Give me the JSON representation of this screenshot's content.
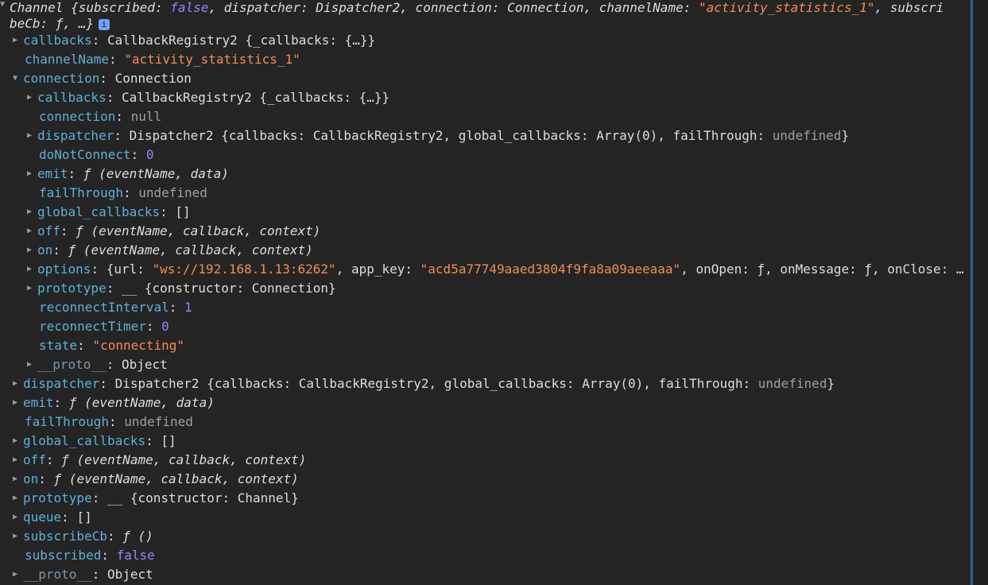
{
  "header": {
    "line1": {
      "prefix": "Channel {subscribed: ",
      "subscribed": "false",
      "mid": ", dispatcher: Dispatcher2, connection: Connection, channelName: ",
      "channel": "\"activity_statistics_1\"",
      "tail": ", subscri"
    },
    "line2": "beCb: ƒ, …}",
    "info_badge": "i"
  },
  "rows": {
    "r01": {
      "key": "callbacks",
      "val": "CallbackRegistry2 {_callbacks: {…}}"
    },
    "r02": {
      "key": "channelName",
      "val": "\"activity_statistics_1\""
    },
    "r03": {
      "key": "connection",
      "val": "Connection"
    },
    "r04": {
      "key": "callbacks",
      "val": "CallbackRegistry2 {_callbacks: {…}}"
    },
    "r05": {
      "key": "connection",
      "val": "null"
    },
    "r06": {
      "key": "dispatcher",
      "val": "Dispatcher2 {callbacks: CallbackRegistry2, global_callbacks: Array(0), failThrough: ",
      "undef": "undefined",
      "close": "}"
    },
    "r07": {
      "key": "doNotConnect",
      "val": "0"
    },
    "r08": {
      "key": "emit",
      "f": "ƒ",
      "sig": " (eventName, data)"
    },
    "r09": {
      "key": "failThrough",
      "val": "undefined"
    },
    "r10": {
      "key": "global_callbacks",
      "val": "[]"
    },
    "r11": {
      "key": "off",
      "f": "ƒ",
      "sig": " (eventName, callback, context)"
    },
    "r12": {
      "key": "on",
      "f": "ƒ",
      "sig": " (eventName, callback, context)"
    },
    "r13": {
      "key": "options",
      "p1": "{url: ",
      "url": "\"ws://192.168.1.13:6262\"",
      "p2": ", app_key: ",
      "app_key": "\"acd5a77749aaed3804f9fa8a09aeeaaa\"",
      "p3": ", onOpen: ƒ, onMessage: ƒ, onClose: ƒ, onError: ƒ}"
    },
    "r14": {
      "key": "prototype",
      "val": "__ {constructor: Connection}"
    },
    "r15": {
      "key": "reconnectInterval",
      "val": "1"
    },
    "r16": {
      "key": "reconnectTimer",
      "val": "0"
    },
    "r17": {
      "key": "state",
      "val": "\"connecting\""
    },
    "r18": {
      "key": "__proto__",
      "val": "Object"
    },
    "r19": {
      "key": "dispatcher",
      "val": "Dispatcher2 {callbacks: CallbackRegistry2, global_callbacks: Array(0), failThrough: ",
      "undef": "undefined",
      "close": "}"
    },
    "r20": {
      "key": "emit",
      "f": "ƒ",
      "sig": " (eventName, data)"
    },
    "r21": {
      "key": "failThrough",
      "val": "undefined"
    },
    "r22": {
      "key": "global_callbacks",
      "val": "[]"
    },
    "r23": {
      "key": "off",
      "f": "ƒ",
      "sig": " (eventName, callback, context)"
    },
    "r24": {
      "key": "on",
      "f": "ƒ",
      "sig": " (eventName, callback, context)"
    },
    "r25": {
      "key": "prototype",
      "val": "__ {constructor: Channel}"
    },
    "r26": {
      "key": "queue",
      "val": "[]"
    },
    "r27": {
      "key": "subscribeCb",
      "f": "ƒ",
      "sig": " ()"
    },
    "r28": {
      "key": "subscribed",
      "val": "false"
    },
    "r29": {
      "key": "__proto__",
      "val": "Object"
    }
  },
  "icons": {
    "collapsed": "▶",
    "expanded": "▼"
  },
  "colors": {
    "background": "#242424",
    "key": "#5db0d7",
    "string": "#f28b54",
    "number": "#9980ff",
    "undefined": "#9aa0a6",
    "info_badge": "#6ea3f7"
  }
}
